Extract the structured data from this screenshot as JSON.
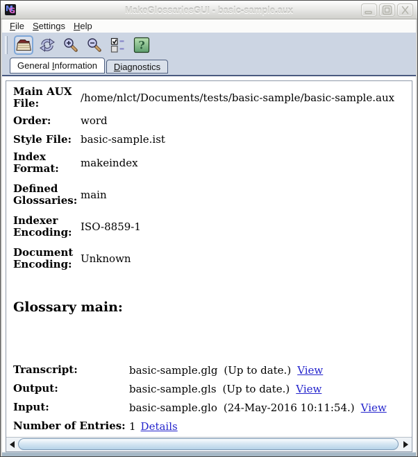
{
  "window": {
    "title": "MakeGlossariesGUI - basic-sample.aux",
    "app_icon_letters": {
      "m": "M",
      "g": "G"
    }
  },
  "menubar": {
    "items": [
      {
        "pre": "",
        "key": "F",
        "post": "ile"
      },
      {
        "pre": "",
        "key": "S",
        "post": "ettings"
      },
      {
        "pre": "",
        "key": "H",
        "post": "elp"
      }
    ]
  },
  "toolbar": {
    "buttons": [
      {
        "icon": "open-folder-icon",
        "focused": true
      },
      {
        "icon": "reload-icon",
        "focused": false
      },
      {
        "icon": "zoom-in-icon",
        "focused": false
      },
      {
        "icon": "zoom-out-icon",
        "focused": false
      },
      {
        "icon": "checklist-icon",
        "focused": false
      },
      {
        "icon": "help-icon",
        "focused": false,
        "glyph": "?"
      }
    ]
  },
  "tabs": [
    {
      "pre": "General ",
      "key": "I",
      "post": "nformation",
      "selected": true
    },
    {
      "pre": "",
      "key": "D",
      "post": "iagnostics",
      "selected": false
    }
  ],
  "general": {
    "fields": [
      {
        "label": "Main AUX File:",
        "value": "/home/nlct/Documents/tests/basic-sample/basic-sample.aux"
      },
      {
        "label": "Order:",
        "value": "word"
      },
      {
        "label": "Style File:",
        "value": "basic-sample.ist"
      },
      {
        "label": "Index Format:",
        "value": "makeindex"
      },
      {
        "label": "Defined Glossaries:",
        "value": "main"
      },
      {
        "label": "Indexer Encoding:",
        "value": "ISO-8859-1"
      },
      {
        "label": "Document Encoding:",
        "value": "Unknown"
      }
    ],
    "glossary_heading": "Glossary main:",
    "files": [
      {
        "label": "Transcript:",
        "file": "basic-sample.glg",
        "status": "(Up to date.)",
        "link": "View"
      },
      {
        "label": "Output:",
        "file": "basic-sample.gls",
        "status": "(Up to date.)",
        "link": "View"
      },
      {
        "label": "Input:",
        "file": "basic-sample.glo",
        "status": "(24-May-2016 10:11:54.)",
        "link": "View"
      }
    ],
    "entries": {
      "label": "Number of Entries:",
      "value": "1",
      "link": "Details"
    }
  },
  "colors": {
    "chrome_background": "#ccd5e3",
    "link_blue": "#2323cc",
    "tab_border": "#49597f",
    "focus_ring": "#7ea7d8",
    "help_green": "#6fae7d",
    "scrollbar_thumb": "#b5d2e8"
  }
}
